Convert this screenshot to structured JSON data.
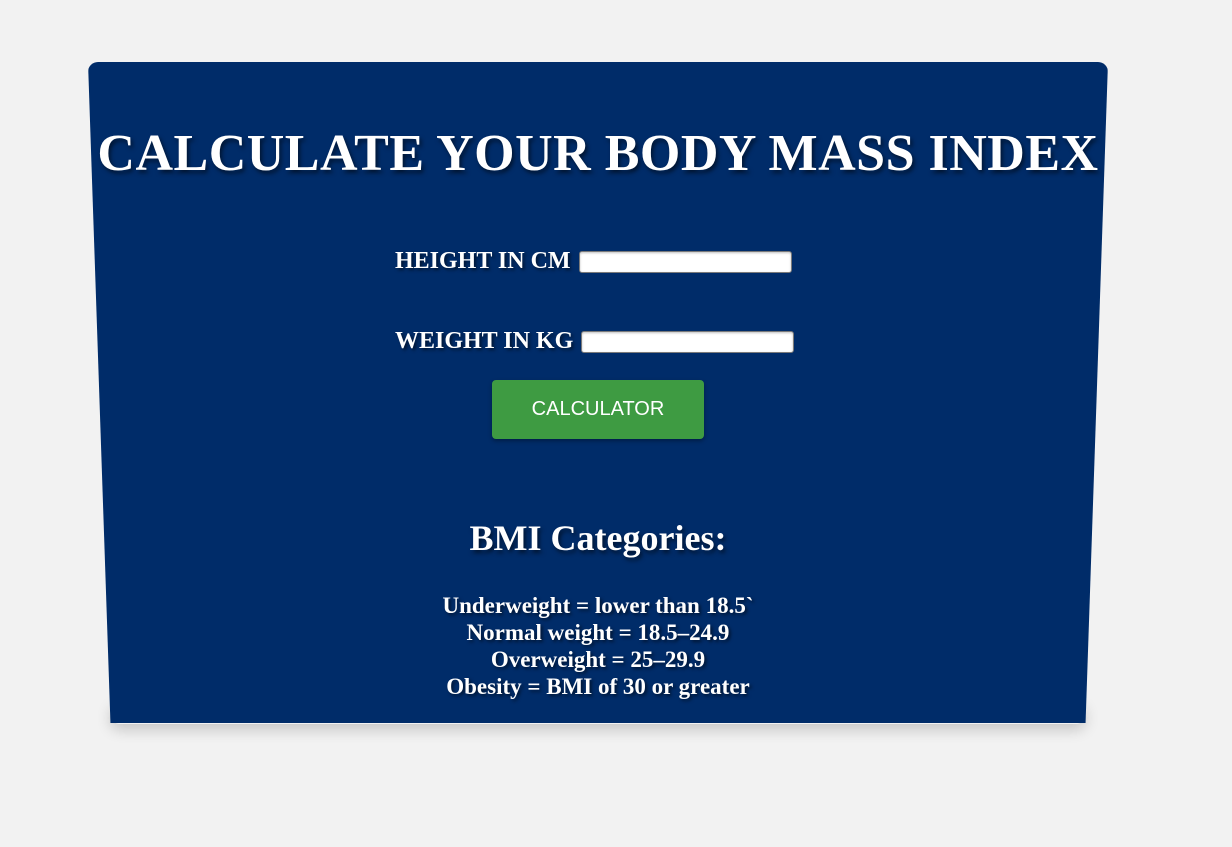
{
  "header": {
    "title": "CALCULATE YOUR BODY MASS INDEX"
  },
  "form": {
    "height_label": "HEIGHT IN CM",
    "height_value": "",
    "weight_label": "WEIGHT IN KG",
    "weight_value": "",
    "button_label": "CALCULATOR"
  },
  "categories": {
    "title": "BMI Categories:",
    "items": [
      "Underweight = lower than 18.5`",
      "Normal weight = 18.5–24.9",
      "Overweight = 25–29.9",
      "Obesity = BMI of 30 or greater"
    ]
  },
  "colors": {
    "page_background": "#f2f2f2",
    "card_background": "#002c69",
    "button_green": "#3e9b42",
    "text": "#ffffff"
  }
}
